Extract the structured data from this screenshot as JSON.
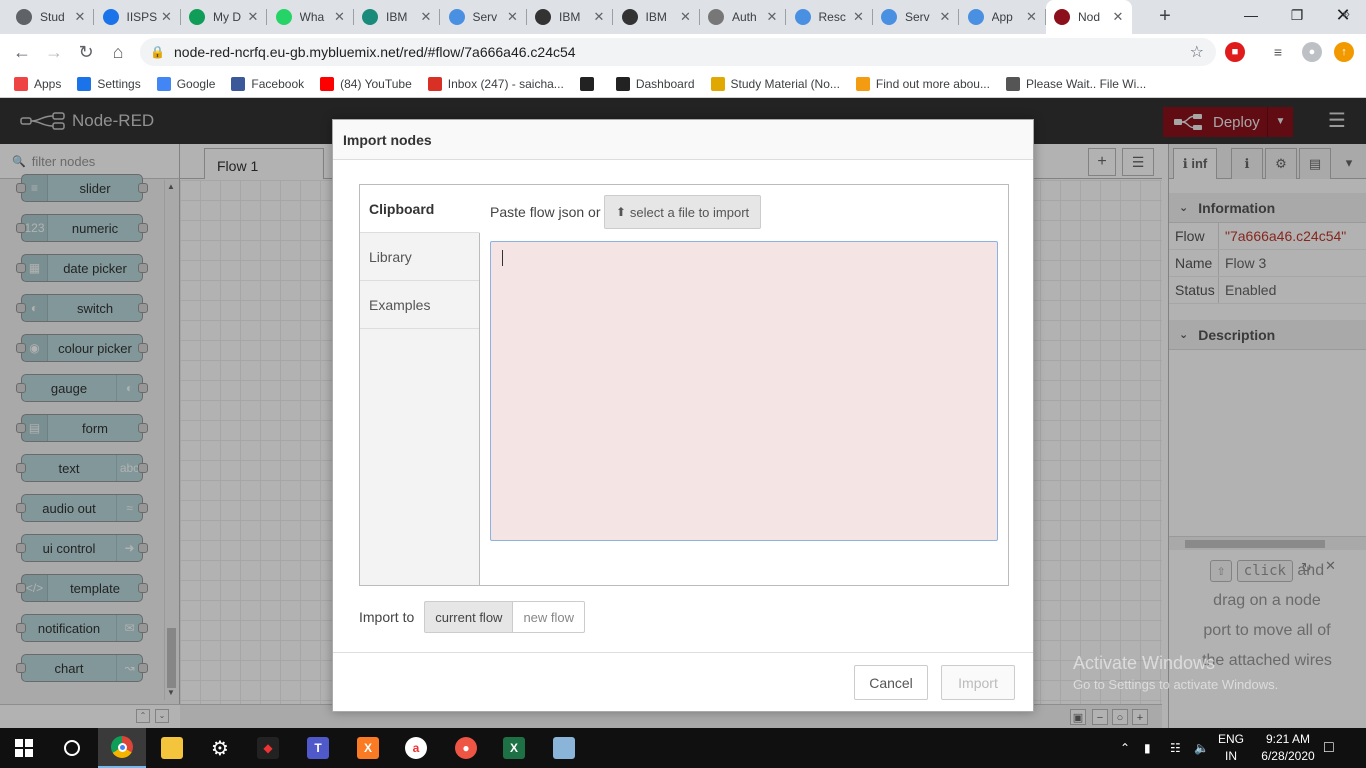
{
  "browser": {
    "tabs": [
      {
        "title": "Stud",
        "icon": "chrome-icon",
        "color": "#5f6368"
      },
      {
        "title": "IISPS",
        "icon": "doc-icon",
        "color": "#1a73e8"
      },
      {
        "title": "My D",
        "icon": "drive-icon",
        "color": "#0f9d58"
      },
      {
        "title": "Wha",
        "icon": "whatsapp-icon",
        "color": "#25d366"
      },
      {
        "title": "IBM",
        "icon": "t-icon",
        "color": "#1a8a7a"
      },
      {
        "title": "Serv",
        "icon": "cloud-icon",
        "color": "#4a90e2"
      },
      {
        "title": "IBM",
        "icon": "bee-icon",
        "color": "#333333"
      },
      {
        "title": "IBM",
        "icon": "bee-icon",
        "color": "#333333"
      },
      {
        "title": "Auth",
        "icon": "globe-icon",
        "color": "#777777"
      },
      {
        "title": "Resc",
        "icon": "cloud-icon",
        "color": "#4a90e2"
      },
      {
        "title": "Serv",
        "icon": "cloud-icon",
        "color": "#4a90e2"
      },
      {
        "title": "App",
        "icon": "cloud-icon",
        "color": "#4a90e2"
      },
      {
        "title": "Nod",
        "icon": "nodered-icon",
        "color": "#8c101c"
      }
    ],
    "url": "node-red-ncrfq.eu-gb.mybluemix.net/red/#flow/7a666a46.c24c54",
    "bookmarks": [
      {
        "label": "Apps",
        "icon": "apps-icon",
        "color": "#e44"
      },
      {
        "label": "Settings",
        "icon": "gear-icon",
        "color": "#1a73e8"
      },
      {
        "label": "Google",
        "icon": "google-icon",
        "color": "#4285f4"
      },
      {
        "label": "Facebook",
        "icon": "facebook-icon",
        "color": "#3b5998"
      },
      {
        "label": "(84) YouTube",
        "icon": "youtube-icon",
        "color": "#ff0000"
      },
      {
        "label": "Inbox (247) - saicha...",
        "icon": "gmail-icon",
        "color": "#d93025"
      },
      {
        "label": "",
        "icon": "amazon-icon",
        "color": "#222"
      },
      {
        "label": "Dashboard",
        "icon": "dashboard-icon",
        "color": "#222"
      },
      {
        "label": "Study Material (No...",
        "icon": "study-icon",
        "color": "#e0a800"
      },
      {
        "label": "Find out more abou...",
        "icon": "diamond-icon",
        "color": "#f39c12"
      },
      {
        "label": "Please Wait.. File Wi...",
        "icon": "globe-icon",
        "color": "#555"
      }
    ]
  },
  "nodered": {
    "app_title": "Node-RED",
    "deploy_label": "Deploy",
    "filter_placeholder": "filter nodes",
    "palette_nodes": [
      {
        "label": "slider",
        "icon": "sliders-icon",
        "icon_side": "left"
      },
      {
        "label": "numeric",
        "icon": "123-icon",
        "icon_side": "left"
      },
      {
        "label": "date picker",
        "icon": "calendar-icon",
        "icon_side": "left"
      },
      {
        "label": "switch",
        "icon": "toggle-icon",
        "icon_side": "left"
      },
      {
        "label": "colour picker",
        "icon": "palette-icon",
        "icon_side": "left"
      },
      {
        "label": "gauge",
        "icon": "gauge-icon",
        "icon_side": "right"
      },
      {
        "label": "form",
        "icon": "form-icon",
        "icon_side": "left"
      },
      {
        "label": "text",
        "icon": "abc-icon",
        "icon_side": "right"
      },
      {
        "label": "audio out",
        "icon": "audio-icon",
        "icon_side": "right"
      },
      {
        "label": "ui control",
        "icon": "arrow-right-icon",
        "icon_side": "right"
      },
      {
        "label": "template",
        "icon": "code-icon",
        "icon_side": "left"
      },
      {
        "label": "notification",
        "icon": "envelope-icon",
        "icon_side": "right"
      },
      {
        "label": "chart",
        "icon": "chart-icon",
        "icon_side": "right"
      }
    ],
    "flow_tab": "Flow 1",
    "sidebar": {
      "tab_label": "inf",
      "info_header": "Information",
      "rows": [
        {
          "key": "Flow",
          "value": "\"7a666a46.c24c54\""
        },
        {
          "key": "Name",
          "value": "Flow 3"
        },
        {
          "key": "Status",
          "value": "Enabled"
        }
      ],
      "desc_header": "Description",
      "help_kbd": "click",
      "help_text_1": "and",
      "help_text_2": "drag on a node",
      "help_text_3": "port to move all of",
      "help_text_4": "the attached wires"
    }
  },
  "dialog": {
    "title": "Import nodes",
    "side_items": [
      "Clipboard",
      "Library",
      "Examples"
    ],
    "paste_label": "Paste flow json or",
    "file_button": "select a file to import",
    "textarea_value": "",
    "import_to_label": "Import to",
    "import_options": [
      "current flow",
      "new flow"
    ],
    "cancel_label": "Cancel",
    "import_label": "Import"
  },
  "watermark": {
    "line1": "Activate Windows",
    "line2": "Go to Settings to activate Windows."
  },
  "taskbar": {
    "lang_top": "ENG",
    "lang_bottom": "IN",
    "time": "9:21 AM",
    "date": "6/28/2020"
  }
}
